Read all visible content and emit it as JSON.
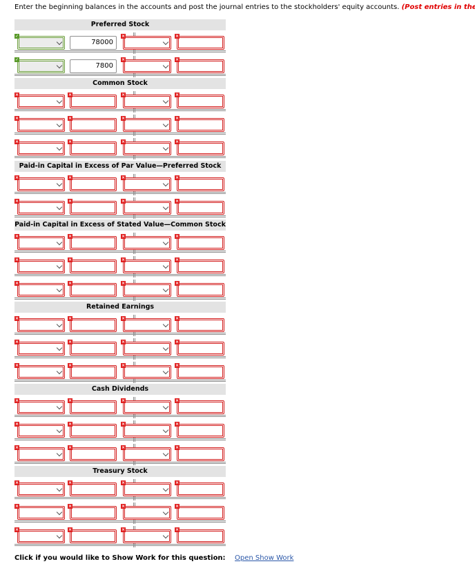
{
  "instructions": {
    "text": "Enter the beginning balances in the accounts and post the journal entries to the stockholders' equity accounts. ",
    "emphasis": "(Post entries in the order of jou"
  },
  "accounts": [
    {
      "title": "Preferred Stock",
      "rows": [
        {
          "state": "ok",
          "left_value": "78000",
          "right_value": ""
        },
        {
          "state": "ok",
          "left_value": "7800",
          "right_value": ""
        }
      ]
    },
    {
      "title": "Common Stock",
      "rows": [
        {
          "state": "err",
          "left_value": "",
          "right_value": ""
        },
        {
          "state": "err",
          "left_value": "",
          "right_value": ""
        },
        {
          "state": "err",
          "left_value": "",
          "right_value": ""
        }
      ]
    },
    {
      "title": "Paid-in Capital in Excess of Par Value—Preferred Stock",
      "rows": [
        {
          "state": "err",
          "left_value": "",
          "right_value": ""
        },
        {
          "state": "err",
          "left_value": "",
          "right_value": ""
        }
      ]
    },
    {
      "title": "Paid-in Capital in Excess of Stated Value—Common Stock",
      "rows": [
        {
          "state": "err",
          "left_value": "",
          "right_value": ""
        },
        {
          "state": "err",
          "left_value": "",
          "right_value": ""
        },
        {
          "state": "err",
          "left_value": "",
          "right_value": ""
        }
      ]
    },
    {
      "title": "Retained Earnings",
      "rows": [
        {
          "state": "err",
          "left_value": "",
          "right_value": ""
        },
        {
          "state": "err",
          "left_value": "",
          "right_value": ""
        },
        {
          "state": "err",
          "left_value": "",
          "right_value": ""
        }
      ]
    },
    {
      "title": "Cash Dividends",
      "rows": [
        {
          "state": "err",
          "left_value": "",
          "right_value": ""
        },
        {
          "state": "err",
          "left_value": "",
          "right_value": ""
        },
        {
          "state": "err",
          "left_value": "",
          "right_value": ""
        }
      ]
    },
    {
      "title": "Treasury Stock",
      "rows": [
        {
          "state": "err",
          "left_value": "",
          "right_value": ""
        },
        {
          "state": "err",
          "left_value": "",
          "right_value": ""
        },
        {
          "state": "err",
          "left_value": "",
          "right_value": ""
        }
      ]
    }
  ],
  "footer": {
    "prompt": "Click if you would like to Show Work for this question:",
    "link": "Open Show Work"
  },
  "colors": {
    "error": "#d21a1a",
    "correct": "#6a9c3a",
    "header_bg": "#e3e3e3",
    "link": "#2a57a8",
    "emphasis": "#e00000"
  },
  "icons": {
    "error_marker": "error-x-icon",
    "correct_marker": "check-icon",
    "dropdown": "chevron-down-icon"
  }
}
